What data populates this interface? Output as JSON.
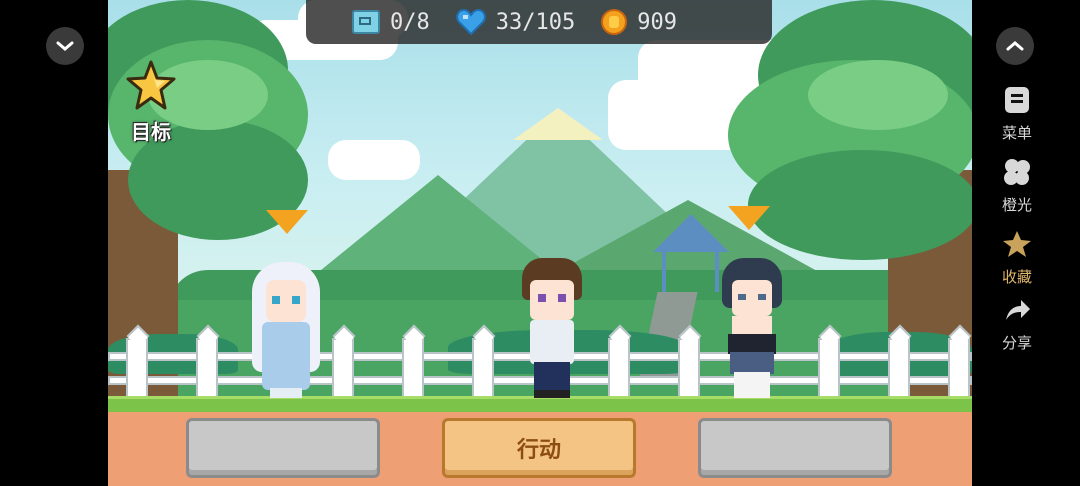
{
  "hud": {
    "map_progress": "0/8",
    "hp": "33/105",
    "coins": "909",
    "map_icon": "map-icon",
    "hp_icon": "heart-icon",
    "coin_icon": "coin-icon"
  },
  "objective": {
    "label": "目标",
    "icon": "star-icon"
  },
  "actions": {
    "left_label": "",
    "center_label": "行动",
    "right_label": ""
  },
  "side_menu": {
    "items": [
      {
        "label": "菜单",
        "icon": "menu-icon"
      },
      {
        "label": "橙光",
        "icon": "orange-light-icon"
      },
      {
        "label": "收藏",
        "icon": "star-icon"
      },
      {
        "label": "分享",
        "icon": "share-icon"
      }
    ],
    "collapse_icon": "chevron-up-icon",
    "left_toggle_icon": "chevron-down-icon"
  },
  "colors": {
    "accent": "#f4a320",
    "button_gold": "#f3c484",
    "hud_bg": "#282828"
  },
  "characters": [
    {
      "name": "silver-haired-girl"
    },
    {
      "name": "brown-haired-boy"
    },
    {
      "name": "dark-haired-girl"
    }
  ]
}
